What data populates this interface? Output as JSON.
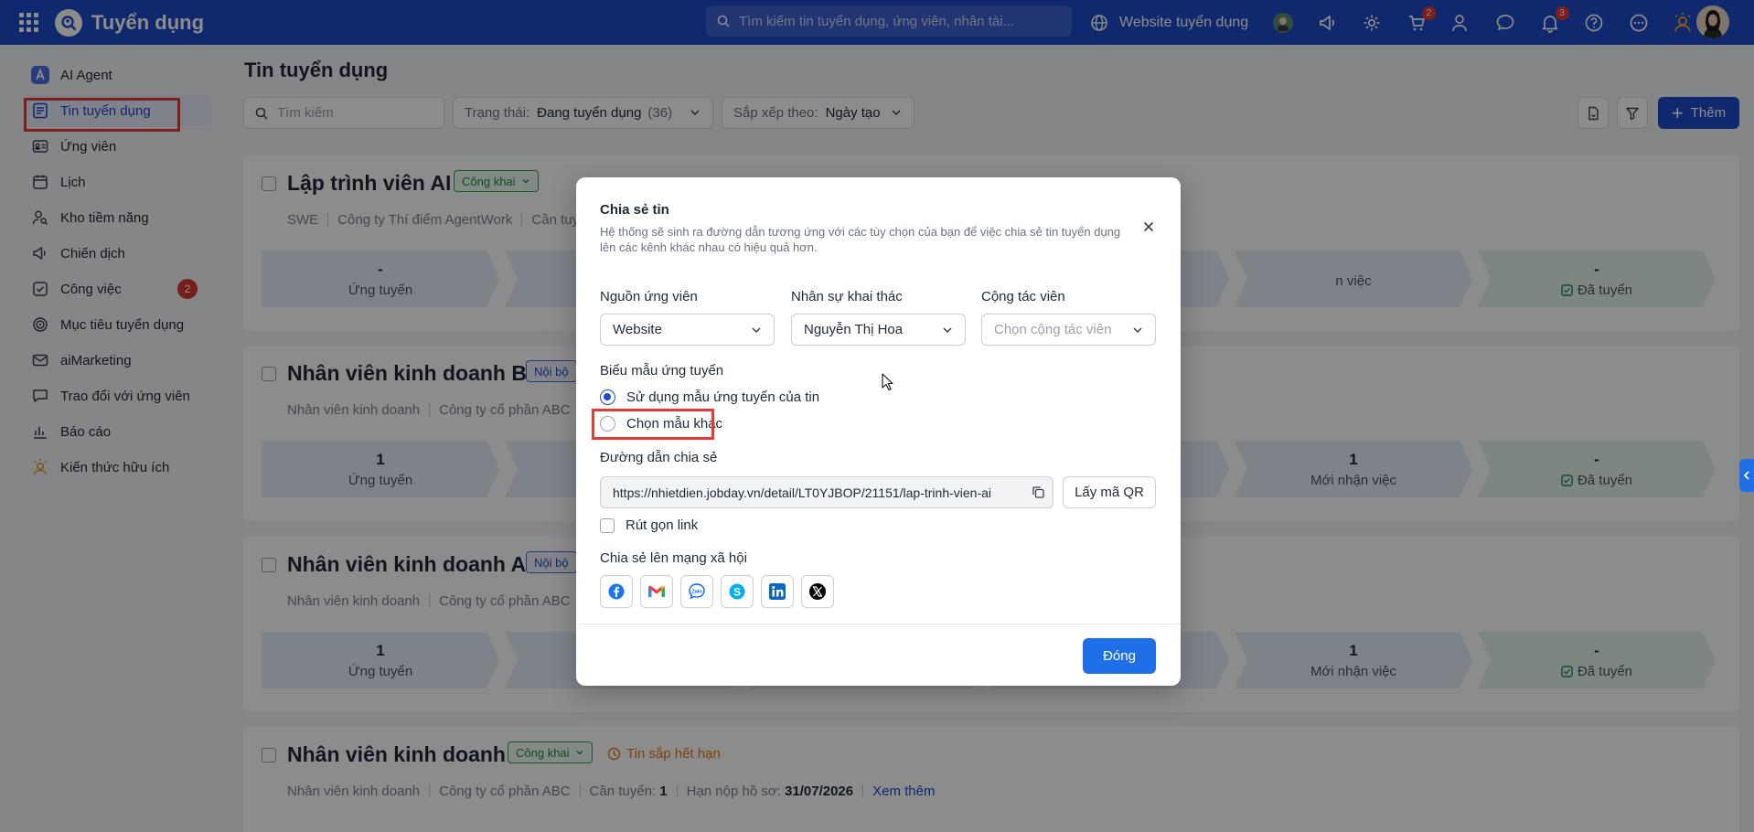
{
  "app": {
    "title": "Tuyển dụng",
    "search_placeholder": "Tìm kiếm tin tuyển dụng, ứng viên, nhân tài...",
    "website_link": "Website tuyển dụng",
    "cart_badge": "2",
    "notification_badge": "3"
  },
  "sidebar": {
    "items": [
      {
        "label": "AI Agent"
      },
      {
        "label": "Tin tuyển dụng"
      },
      {
        "label": "Ứng viên"
      },
      {
        "label": "Lịch"
      },
      {
        "label": "Kho tiềm năng"
      },
      {
        "label": "Chiến dịch"
      },
      {
        "label": "Công việc",
        "badge": "2"
      },
      {
        "label": "Mục tiêu tuyển dụng"
      },
      {
        "label": "aiMarketing"
      },
      {
        "label": "Trao đổi với ứng viên"
      },
      {
        "label": "Báo cáo"
      },
      {
        "label": "Kiến thức hữu ích"
      }
    ]
  },
  "main": {
    "title": "Tin tuyển dụng",
    "search_placeholder": "Tìm kiếm",
    "status_filter": {
      "label": "Trạng thái:",
      "value": "Đang tuyển dụng",
      "count": "(36)"
    },
    "sort_filter": {
      "label": "Sắp xếp theo:",
      "value": "Ngày tạo"
    },
    "add_label": "Thêm",
    "jobs": [
      {
        "title": "Lập trình viên AI",
        "tag": "Công khai",
        "meta": [
          "SWE",
          "Công ty Thí điểm AgentWork",
          "Cần tuy"
        ],
        "stages": [
          {
            "num": "-",
            "label": "Ứng tuyển"
          },
          {
            "num": "",
            "label": "n việc"
          },
          {
            "num": "-",
            "label": "Đã tuyển"
          }
        ]
      },
      {
        "title": "Nhân viên kinh doanh B",
        "tag": "Nội bộ",
        "meta": [
          "Nhân viên kinh doanh",
          "Công ty cổ phần ABC"
        ],
        "stages": [
          {
            "num": "1",
            "label": "Ứng tuyển"
          },
          {
            "num": "1",
            "label": "Mới nhận việc"
          },
          {
            "num": "-",
            "label": "Đã tuyển"
          }
        ]
      },
      {
        "title": "Nhân viên kinh doanh A",
        "tag": "Nội bộ",
        "meta": [
          "Nhân viên kinh doanh",
          "Công ty cổ phần ABC"
        ],
        "stages": [
          {
            "num": "1",
            "label": "Ứng tuyển"
          },
          {
            "num": "1",
            "label": "Mới nhận việc"
          },
          {
            "num": "-",
            "label": "Đã tuyển"
          }
        ]
      },
      {
        "title": "Nhân viên kinh doanh",
        "tag": "Công khai",
        "expire": "Tin sắp hết hạn",
        "meta_parts": {
          "type": "Nhân viên kinh doanh",
          "company": "Công ty cổ phần ABC",
          "need_label": "Cần tuyển:",
          "need_value": "1",
          "deadline_label": "Hạn nộp hồ sơ:",
          "deadline_value": "31/07/2026",
          "more": "Xem thêm"
        }
      }
    ]
  },
  "modal": {
    "title": "Chia sẻ tin",
    "description": "Hệ thống sẽ sinh ra đường dẫn tương ứng với các tùy chọn của bạn để việc chia sẻ tin tuyển dụng lên các kênh khác nhau có hiệu quả hơn.",
    "source_label": "Nguồn ứng viên",
    "source_value": "Website",
    "staff_label": "Nhân sự khai thác",
    "staff_value": "Nguyễn Thị Hoa",
    "collab_label": "Cộng tác viên",
    "collab_placeholder": "Chọn cộng tác viên",
    "form_label": "Biểu mẫu ứng tuyển",
    "form_option_default": "Sử dụng mẫu ứng tuyển của tin",
    "form_option_other": "Chọn mẫu khác",
    "link_label": "Đường dẫn chia sẻ",
    "link_value": "https://nhietdien.jobday.vn/detail/LT0YJBOP/21151/lap-trinh-vien-ai",
    "qr_label": "Lấy mã QR",
    "shorten_label": "Rút gọn link",
    "social_label": "Chia sẻ lên mạng xã hội",
    "socials": [
      "facebook-icon",
      "gmail-icon",
      "zalo-icon",
      "skype-icon",
      "linkedin-icon",
      "x-icon"
    ],
    "close_label": "Đóng"
  },
  "colors": {
    "primary": "#1e49c7",
    "button": "#1e6fe8",
    "highlight": "#e53935",
    "badge": "#d73a30"
  }
}
